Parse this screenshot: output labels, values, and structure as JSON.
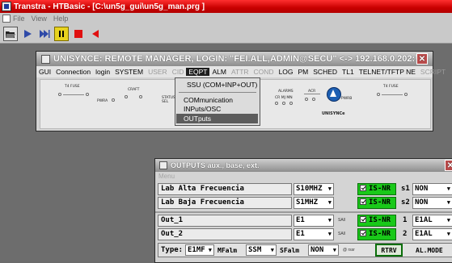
{
  "app": {
    "title": "Transtra - HTBasic - [C:\\un5g_gui\\un5g_man.prg ]",
    "menu": [
      "File",
      "View",
      "Help"
    ],
    "toolbar_icons": [
      "open-folder-icon",
      "run-icon",
      "step-icon",
      "pause-icon",
      "stop-icon",
      "back-icon"
    ]
  },
  "remote_manager": {
    "title": "UNISYNCE: REMOTE MANAGER, LOGIN: \"FEI.ALL,ADMIN@SECU\" <-> 192.168.0.202:71",
    "menu": [
      {
        "label": "GUI",
        "state": "normal"
      },
      {
        "label": "Connection",
        "state": "normal"
      },
      {
        "label": "login",
        "state": "normal"
      },
      {
        "label": "SYSTEM",
        "state": "normal"
      },
      {
        "label": "USER",
        "state": "disabled"
      },
      {
        "label": "CID",
        "state": "disabled"
      },
      {
        "label": "EQPT",
        "state": "active"
      },
      {
        "label": "ALM",
        "state": "normal"
      },
      {
        "label": "ATTR",
        "state": "disabled"
      },
      {
        "label": "COND",
        "state": "disabled"
      },
      {
        "label": "LOG",
        "state": "normal"
      },
      {
        "label": "PM",
        "state": "normal"
      },
      {
        "label": "SCHED",
        "state": "normal"
      },
      {
        "label": "TL1",
        "state": "normal"
      },
      {
        "label": "TELNET/TFTP NE",
        "state": "normal"
      },
      {
        "label": "SCRIPT",
        "state": "disabled"
      }
    ],
    "diagram": {
      "labels": {
        "t4_fuse": "T4 FUSE",
        "pwr_a": "PWRA",
        "craft": "CRAFT",
        "status_sel": "STATUS / SEL",
        "alarms": "ALARMS",
        "alarm_cols": "CR MJ MN",
        "acr": "ACR",
        "pwr_b": "PWRB",
        "t4_fuse_right": "T4 FUSE",
        "brand": "UNISYNCe"
      }
    },
    "eqpt_menu": {
      "items": [
        "SSU (COM+INP+OUT)",
        "COMmunication",
        "INPuts/OSC",
        "OUTputs"
      ],
      "highlighted": "OUTputs"
    }
  },
  "outputs": {
    "title": "OUTPUTS aux., base, ext.",
    "menu_label": "Menu",
    "aux_rows": [
      {
        "name": "Lab Alta Frecuencia",
        "freq": "S10MHZ",
        "status": "IS-NR",
        "slot": "s1",
        "mode": "NON"
      },
      {
        "name": "Lab Baja Frecuencia",
        "freq": "S1MHZ",
        "status": "IS-NR",
        "slot": "s2",
        "mode": "NON"
      }
    ],
    "out_rows": [
      {
        "name": "Out_1",
        "freq": "E1",
        "small": "SAll",
        "status": "IS-NR",
        "slot": "1",
        "mode": "E1AL"
      },
      {
        "name": "Out_2",
        "freq": "E1",
        "small": "SAll",
        "status": "IS-NR",
        "slot": "2",
        "mode": "E1AL"
      }
    ],
    "footer": {
      "type_label": "Type:",
      "type_value": "E1MF",
      "mfalm_label": "MFalm",
      "mfalm_value": "SSM",
      "sfalm_label": "SFalm",
      "sfalm_value": "NON",
      "small_note": "@ rssr",
      "rtrv_label": "RTRV",
      "al_mode": "AL.MODE"
    }
  },
  "colors": {
    "status_green": "#19c919",
    "app_title_red": "#c80000"
  }
}
